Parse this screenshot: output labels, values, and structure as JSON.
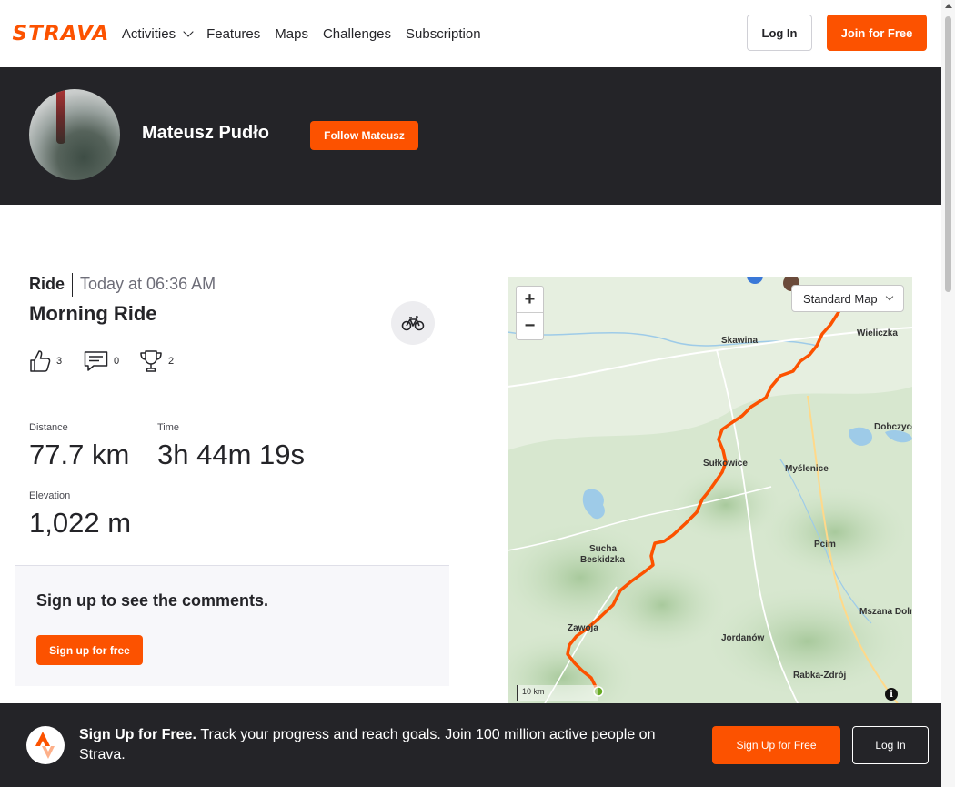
{
  "nav": {
    "logo": "STRAVA",
    "items": [
      "Activities",
      "Features",
      "Maps",
      "Challenges",
      "Subscription"
    ],
    "login_label": "Log In",
    "join_label": "Join for Free"
  },
  "athlete": {
    "name": "Mateusz Pudło",
    "follow_label": "Follow Mateusz"
  },
  "activity": {
    "type": "Ride",
    "time": "Today at 06:36 AM",
    "name": "Morning Ride",
    "sport_icon": "bike-icon",
    "kudos": "3",
    "comments": "0",
    "achievements": "2",
    "stats": [
      {
        "label": "Distance",
        "value": "77.7 km"
      },
      {
        "label": "Time",
        "value": "3h 44m 19s"
      },
      {
        "label": "Elevation",
        "value": "1,022 m"
      }
    ]
  },
  "comments_box": {
    "title": "Sign up to see the comments.",
    "button": "Sign up for free"
  },
  "map": {
    "zoom_in": "+",
    "zoom_out": "−",
    "style_select": "Standard Map",
    "scale": "10 km",
    "info": "i",
    "places": [
      "Skawina",
      "Wieliczka",
      "Dobczyce",
      "Sułkowice",
      "Myślenice",
      "Sucha Beskidzka",
      "Pcim",
      "Zawoja",
      "Jordanów",
      "Mszana Dolna",
      "Rabka-Zdrój"
    ],
    "route_color": "#fc5200"
  },
  "banner": {
    "headline": "Sign Up for Free.",
    "text": "Track your progress and reach goals. Join 100 million active people on Strava.",
    "signup_label": "Sign Up for Free",
    "login_label": "Log In"
  },
  "colors": {
    "brand": "#fc5200",
    "dark": "#242428"
  }
}
